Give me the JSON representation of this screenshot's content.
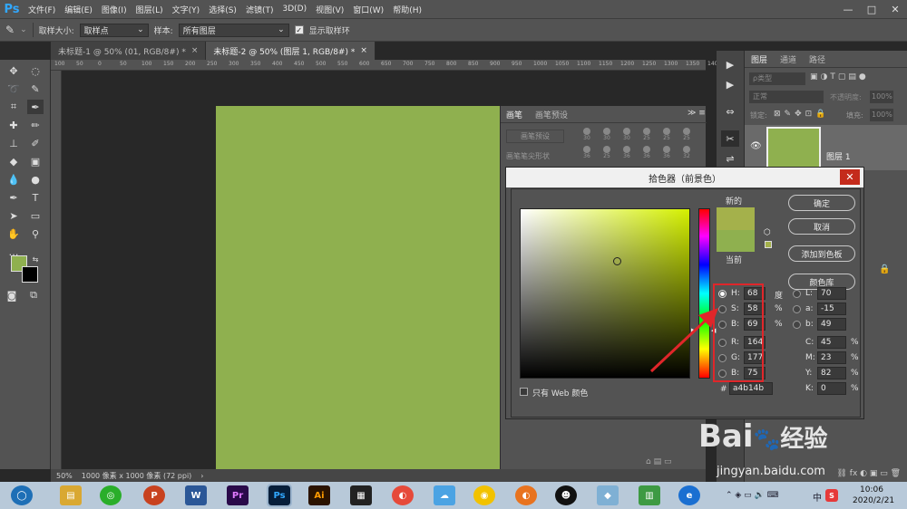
{
  "app": {
    "logo": "Ps"
  },
  "menubar": {
    "items": [
      "文件(F)",
      "编辑(E)",
      "图像(I)",
      "图层(L)",
      "文字(Y)",
      "选择(S)",
      "滤镜(T)",
      "3D(D)",
      "视图(V)",
      "窗口(W)",
      "帮助(H)"
    ]
  },
  "window_controls": {
    "minimize": "—",
    "maximize": "□",
    "close": "✕"
  },
  "options_bar": {
    "sample_size_label": "取样大小:",
    "sample_size_value": "取样点",
    "sample_label": "样本:",
    "sample_value": "所有图层",
    "show_ring_label": "显示取样环",
    "show_ring_checked": true
  },
  "document_tabs": [
    {
      "label": "未标题-1 @ 50% (01, RGB/8#) *",
      "close": "×",
      "active": false
    },
    {
      "label": "未标题-2 @ 50% (图层 1, RGB/8#) *",
      "close": "×",
      "active": true
    }
  ],
  "ruler_ticks": [
    "100",
    "50",
    "0",
    "50",
    "100",
    "150",
    "200",
    "250",
    "300",
    "350",
    "400",
    "450",
    "500",
    "550",
    "600",
    "650",
    "700",
    "750",
    "800",
    "850",
    "900",
    "950",
    "1000",
    "1050",
    "1100",
    "1150",
    "1200",
    "1250",
    "1300",
    "1350",
    "1400"
  ],
  "statusbar": {
    "zoom": "50%",
    "doc_info": "1000 像素 x 1000 像素 (72 ppi)"
  },
  "brush_panel": {
    "tabs": [
      "画笔",
      "画笔预设"
    ],
    "buttons": [
      "画笔预设",
      "画笔笔尖形状"
    ],
    "sizes": [
      "30",
      "30",
      "30",
      "25",
      "25",
      "25",
      "36",
      "25",
      "36",
      "36",
      "36",
      "32"
    ]
  },
  "layers_panel": {
    "tabs": [
      "图层",
      "通道",
      "路径"
    ],
    "filter_label": "ρ类型",
    "blend_mode": "正常",
    "opacity_label": "不透明度:",
    "opacity_value": "100%",
    "lock_label": "锁定:",
    "fill_label": "填充:",
    "fill_value": "100%",
    "layer_name": "图层 1",
    "layer_color": "#8fb04f"
  },
  "color_picker": {
    "title": "拾色器（前景色）",
    "new_label": "新的",
    "current_label": "当前",
    "new_color": "#a4b14b",
    "current_color": "#8fb04f",
    "buttons": {
      "ok": "确定",
      "cancel": "取消",
      "add_swatch": "添加到色板",
      "libraries": "颜色库"
    },
    "hsb": {
      "h": "68",
      "s": "58",
      "b": "69"
    },
    "rgb": {
      "r": "164",
      "g": "177",
      "b": "75"
    },
    "lab": {
      "l": "70",
      "a": "-15",
      "b": "49"
    },
    "cmyk": {
      "c": "45",
      "m": "23",
      "y": "82",
      "k": "0"
    },
    "labels": {
      "h": "H:",
      "s": "S:",
      "b": "B:",
      "r": "R:",
      "g": "G:",
      "bb": "B:",
      "l": "L:",
      "a": "a:",
      "lb": "b:",
      "c": "C:",
      "m": "M:",
      "y": "Y:",
      "k": "K:"
    },
    "units": {
      "deg": "度",
      "pct": "%"
    },
    "hex_label": "#",
    "hex": "a4b14b",
    "web_only_label": "只有 Web 颜色",
    "web_only_checked": false,
    "hue_channel_selected": "H"
  },
  "annotation": {
    "color": "#e0262a"
  },
  "watermark": {
    "logo_text": "Bai",
    "logo_text2": "经验",
    "url": "jingyan.baidu.com"
  },
  "taskbar": {
    "clock_time": "10:06",
    "clock_date": "2020/2/21",
    "tray_text": "中"
  }
}
